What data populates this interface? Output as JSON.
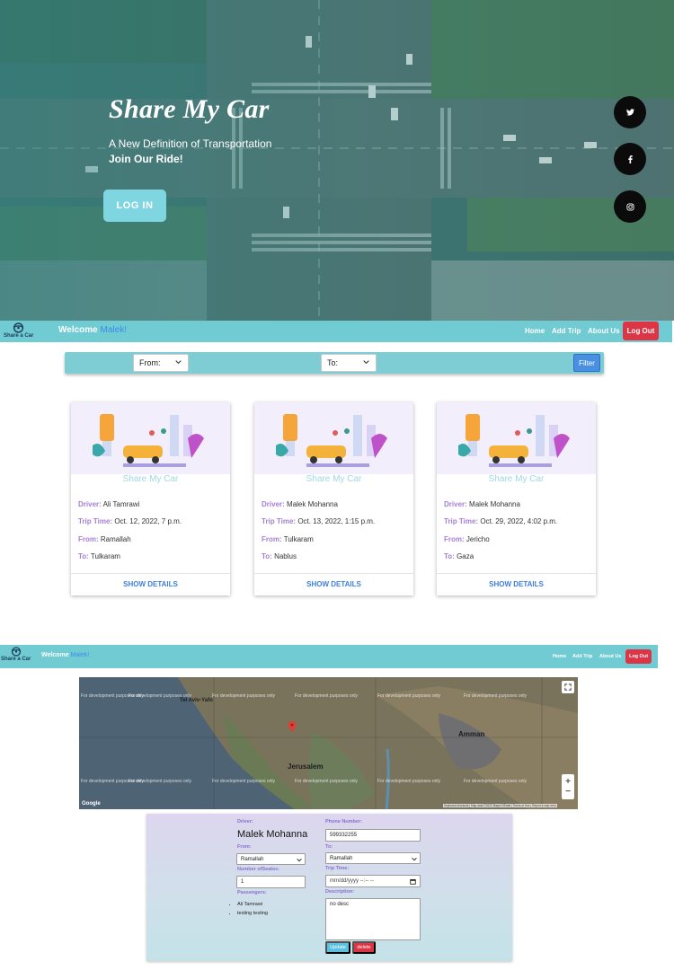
{
  "hero": {
    "title": "Share My Car",
    "subtitle_line1": "A New Definition of Transportation",
    "subtitle_line2": "Join Our Ride!",
    "login_button": "LOG IN",
    "social": [
      "twitter-icon",
      "facebook-icon",
      "instagram-icon"
    ]
  },
  "navbar": {
    "logo_text": "Share a Car",
    "welcome": "Welcome",
    "username": "Malek!",
    "links": [
      "Home",
      "Add Trip",
      "About Us"
    ],
    "logout": "Log Out"
  },
  "filter": {
    "from_value": "From:",
    "to_value": "To:",
    "button": "Filter"
  },
  "cards": [
    {
      "title": "Share My Car",
      "driver_label": "Driver:",
      "driver": "Ali Tamrawi",
      "time_label": "Trip Time:",
      "time": "Oct. 12, 2022, 7 p.m.",
      "from_label": "From:",
      "from": "Ramallah",
      "to_label": "To:",
      "to": "Tulkaram",
      "action": "SHOW DETAILS"
    },
    {
      "title": "Share My Car",
      "driver_label": "Driver:",
      "driver": "Malek Mohanna",
      "time_label": "Trip Time:",
      "time": "Oct. 13, 2022, 1:15 p.m.",
      "from_label": "From:",
      "from": "Tulkaram",
      "to_label": "To:",
      "to": "Nablus",
      "action": "SHOW DETAILS"
    },
    {
      "title": "Share My Car",
      "driver_label": "Driver:",
      "driver": "Malek Mohanna",
      "time_label": "Trip Time:",
      "time": "Oct. 29, 2022, 4:02 p.m.",
      "from_label": "From:",
      "from": "Jericho",
      "to_label": "To:",
      "to": "Gaza",
      "action": "SHOW DETAILS"
    }
  ],
  "map": {
    "watermark": "For development purposes only",
    "labels": {
      "tel_aviv": "Tel Aviv-Yafo",
      "amman": "Amman",
      "jerusalem": "Jerusalem"
    },
    "attribution": "Keyboard shortcuts | Map data ©2022 Mapa GISrael | Terms of Use | Report a map error",
    "google": "Google",
    "zoom_in": "+",
    "zoom_out": "−"
  },
  "trip_form": {
    "driver_label": "Driver:",
    "driver_name": "Malek Mohanna",
    "from_label": "From:",
    "from_value": "Ramallah",
    "seats_label": "Number ofSeates:",
    "seats_value": "1",
    "passengers_label": "Passengers:",
    "passengers": [
      "Ali Tamrawi",
      "testing testing"
    ],
    "phone_label": "Phone Number:",
    "phone_value": "599332255",
    "to_label": "To:",
    "to_value": "Ramallah",
    "time_label": "Trip Time:",
    "time_placeholder": "mm/dd/yyyy --:-- --",
    "desc_label": "Description:",
    "desc_value": "no desc",
    "update_button": "Update",
    "delete_button": "delete"
  }
}
